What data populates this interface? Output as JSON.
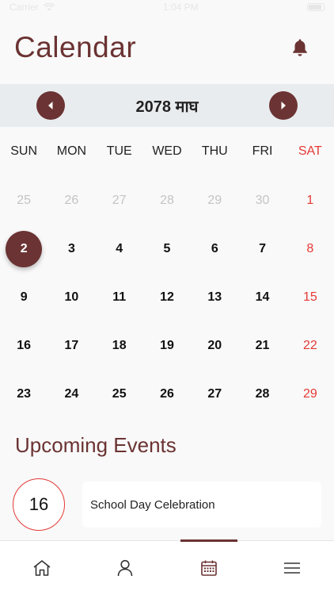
{
  "status_bar": {
    "carrier": "Carrier",
    "time": "1:04 PM"
  },
  "header": {
    "title": "Calendar"
  },
  "month_nav": {
    "label": "2078 माघ"
  },
  "weekdays": [
    "SUN",
    "MON",
    "TUE",
    "WED",
    "THU",
    "FRI",
    "SAT"
  ],
  "days": [
    {
      "label": "25",
      "state": "muted"
    },
    {
      "label": "26",
      "state": "muted"
    },
    {
      "label": "27",
      "state": "muted"
    },
    {
      "label": "28",
      "state": "muted"
    },
    {
      "label": "29",
      "state": "muted"
    },
    {
      "label": "30",
      "state": "muted"
    },
    {
      "label": "1",
      "state": "sat"
    },
    {
      "label": "2",
      "state": "selected"
    },
    {
      "label": "3",
      "state": "normal"
    },
    {
      "label": "4",
      "state": "normal"
    },
    {
      "label": "5",
      "state": "normal"
    },
    {
      "label": "6",
      "state": "normal"
    },
    {
      "label": "7",
      "state": "normal"
    },
    {
      "label": "8",
      "state": "sat"
    },
    {
      "label": "9",
      "state": "normal"
    },
    {
      "label": "10",
      "state": "normal"
    },
    {
      "label": "11",
      "state": "normal"
    },
    {
      "label": "12",
      "state": "normal"
    },
    {
      "label": "13",
      "state": "normal"
    },
    {
      "label": "14",
      "state": "normal"
    },
    {
      "label": "15",
      "state": "sat"
    },
    {
      "label": "16",
      "state": "normal"
    },
    {
      "label": "17",
      "state": "normal"
    },
    {
      "label": "18",
      "state": "normal"
    },
    {
      "label": "19",
      "state": "normal"
    },
    {
      "label": "20",
      "state": "normal"
    },
    {
      "label": "21",
      "state": "normal"
    },
    {
      "label": "22",
      "state": "sat"
    },
    {
      "label": "23",
      "state": "normal"
    },
    {
      "label": "24",
      "state": "normal"
    },
    {
      "label": "25",
      "state": "normal"
    },
    {
      "label": "26",
      "state": "normal"
    },
    {
      "label": "27",
      "state": "normal"
    },
    {
      "label": "28",
      "state": "normal"
    },
    {
      "label": "29",
      "state": "sat"
    }
  ],
  "upcoming": {
    "title": "Upcoming Events",
    "events": [
      {
        "day": "16",
        "name": "School Day Celebration"
      }
    ]
  },
  "tabs": [
    {
      "name": "home",
      "icon": "home-icon",
      "active": false
    },
    {
      "name": "profile",
      "icon": "user-icon",
      "active": false
    },
    {
      "name": "calendar",
      "icon": "calendar-icon",
      "active": true
    },
    {
      "name": "menu",
      "icon": "menu-icon",
      "active": false
    }
  ],
  "colors": {
    "brand": "#6b3333",
    "weekend": "#e53935",
    "muted": "#c4c4c4"
  }
}
